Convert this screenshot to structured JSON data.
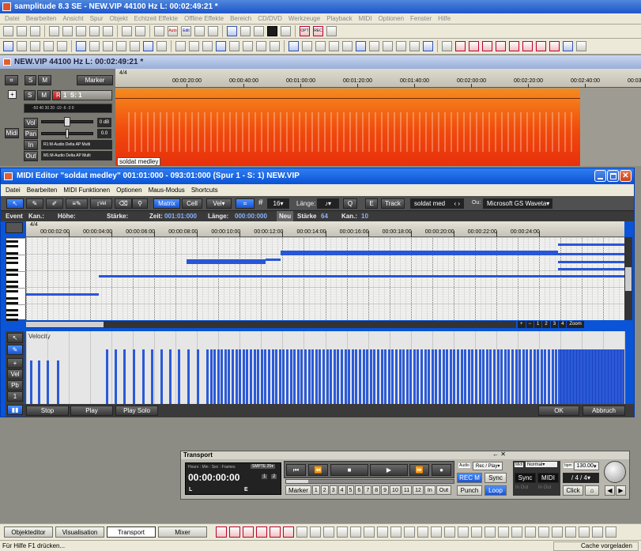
{
  "app": {
    "title": "samplitude 8.3 SE  -  NEW.VIP   44100 Hz L: 00:02:49:21 *"
  },
  "menubar": [
    "Datei",
    "Bearbeiten",
    "Ansicht",
    "Spur",
    "Objekt",
    "Echtzeit Effekte",
    "Offline Effekte",
    "Bereich",
    "CD/DVD",
    "Werkzeuge",
    "Playback",
    "MIDI",
    "Optionen",
    "Fenster",
    "Hilfe"
  ],
  "toolbar_labels": {
    "auto": "Auto",
    "edit": "Edit",
    "opt": "OPT",
    "rec": "REC"
  },
  "vip": {
    "title": "NEW.VIP   44100 Hz L: 00:02:49:21 *",
    "s": "S",
    "m": "M",
    "marker": "Marker",
    "signature": "4/4",
    "ruler": [
      "00:00:20:00",
      "00:00:40:00",
      "00:01:00:00",
      "00:01:20:00",
      "00:01:40:00",
      "00:02:00:00",
      "00:02:20:00",
      "00:02:40:00",
      "00:03:00:00"
    ],
    "track": {
      "s": "S",
      "m": "M",
      "r": "R",
      "number": "1",
      "name": "S: 1",
      "meter_scale": "-50 40 30 20 -10 -6 -3 0",
      "vol_label": "Vol",
      "vol_value": "0 dB",
      "pan_label": "Pan",
      "pan_value": "0.0",
      "in_label": "In",
      "in_value": "R1:M-Audio Delta AP Multi",
      "midi_label": "Midi",
      "out_label": "Out",
      "out_value": "M1:M-Audio Delta AP Multi",
      "object_name": "soldat medley"
    }
  },
  "midi": {
    "title": "MIDI Editor \"soldat medley\" 001:01:000 - 093:01:000 (Spur 1 - S: 1) NEW.VIP",
    "menu": [
      "Datei",
      "Bearbeiten",
      "MIDI Funktionen",
      "Optionen",
      "Maus-Modus",
      "Shortcuts"
    ],
    "toolbar": {
      "vel_tool": "Vel",
      "matrix": "Matrix",
      "cell": "Cell",
      "vel": "Vel",
      "quant": "16",
      "laenge_label": "Länge:",
      "laenge_value": "♪",
      "q": "Q",
      "e": "E",
      "track": "Track",
      "track_name": "soldat med",
      "out_label": "Ou:",
      "out_value": "Microsoft GS Waveta"
    },
    "info": {
      "event": "Event",
      "kan": "Kan.:",
      "hoehe": "Höhe:",
      "staerke": "Stärke:",
      "zeit_label": "Zeit:",
      "zeit_value": "001:01:000",
      "laenge_label": "Länge:",
      "laenge_value": "000:00:000",
      "neu": "Neu",
      "staerke2_label": "Stärke",
      "staerke2_value": "64",
      "kan2_label": "Kan.:",
      "kan2_value": "10"
    },
    "signature": "4/4",
    "ruler": [
      "00:00:02:00",
      "00:00:04:00",
      "00:00:06:00",
      "00:00:08:00",
      "00:00:10:00",
      "00:00:12:00",
      "00:00:14:00",
      "00:00:16:00",
      "00:00:18:00",
      "00:00:20:00",
      "00:00:22:00",
      "00:00:24:00"
    ],
    "zoom_buttons": [
      "+",
      "−",
      "1",
      "2",
      "3",
      "4"
    ],
    "zoom_label": "Zoom",
    "velocity_label": "Velocity",
    "side_tools": [
      "+",
      "Vel",
      "Pb",
      "1"
    ],
    "buttons": {
      "stop": "Stop",
      "play": "Play",
      "play_solo": "Play Solo",
      "ok": "OK",
      "abbruch": "Abbruch"
    },
    "notes": [
      [
        0,
        3.4,
        71
      ],
      [
        3.4,
        28,
        48
      ],
      [
        7.5,
        11.2,
        31
      ],
      [
        7.5,
        11.2,
        28
      ],
      [
        11.2,
        11.9,
        27
      ],
      [
        11.9,
        24.9,
        17
      ],
      [
        11.9,
        24.9,
        18
      ],
      [
        11.9,
        24.9,
        19
      ],
      [
        11.9,
        24.9,
        20
      ],
      [
        24.9,
        28,
        8
      ],
      [
        24.9,
        28,
        20
      ],
      [
        24.9,
        28,
        30
      ],
      [
        24.9,
        28,
        39
      ]
    ],
    "velocity": {
      "low": [
        0.2,
        0.55,
        0.95,
        1.45,
        3.75,
        4.15,
        4.55,
        5.0,
        5.45,
        5.85,
        6.3,
        6.7,
        7.1,
        7.55,
        8.0,
        8.45
      ],
      "dense_from": 8.6,
      "dense_to": 24.9,
      "dense_step": 0.17,
      "dense_level": 0.75,
      "tail_from": 24.9,
      "tail_to": 28,
      "tail_level": 0.75
    }
  },
  "transport": {
    "title": "Transport",
    "hours_label": "Hours : Min : Sec : Frames",
    "smpte": "SMPTE 25",
    "time": "00:00:00:00",
    "l": "L",
    "e": "E",
    "n1": "1",
    "n2": "2",
    "audio_label": "Audio",
    "recplay": "Rec / Play",
    "recm": "REC M",
    "sync": "Sync",
    "marker": "Marker",
    "markers": [
      "1",
      "2",
      "3",
      "4",
      "5",
      "6",
      "7",
      "8",
      "9",
      "10",
      "11",
      "12"
    ],
    "in": "In",
    "out": "Out",
    "punch": "Punch",
    "loop": "Loop",
    "midi_label": "Midi",
    "normal": "Normal",
    "bpm_label": "bpm",
    "bpm": "130.00",
    "sync2": "Sync",
    "midi2": "MIDI",
    "inout1": "In Out",
    "inout2": "In Out",
    "sig_l": "/",
    "sig": "4 / 4",
    "click": "Click"
  },
  "bottom": {
    "tabs": [
      "Objekteditor",
      "Visualisation",
      "Transport",
      "Mixer"
    ],
    "active": "Transport"
  },
  "status": {
    "left": "Für Hilfe F1 drücken...",
    "right": "Cache vorgeladen"
  }
}
